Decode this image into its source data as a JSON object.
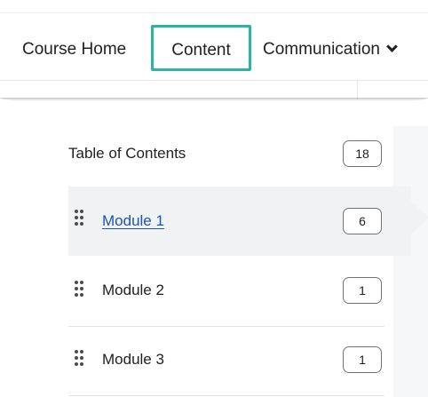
{
  "navbar": {
    "items": [
      {
        "label": "Course Home"
      },
      {
        "label": "Content",
        "active": true
      },
      {
        "label": "Communication",
        "has_dropdown": true,
        "dropdown_icon": "chevron-down-icon"
      }
    ],
    "active_outline_color": "#2bb5a0"
  },
  "toc": {
    "header": {
      "label": "Table of Contents",
      "count": "18"
    },
    "modules": [
      {
        "label": "Module 1",
        "count": "6",
        "selected": true,
        "icon": "drag-handle-icon"
      },
      {
        "label": "Module 2",
        "count": "1",
        "selected": false,
        "icon": "drag-handle-icon"
      },
      {
        "label": "Module 3",
        "count": "1",
        "selected": false,
        "icon": "drag-handle-icon"
      }
    ],
    "link_color": "#1a57a8"
  }
}
